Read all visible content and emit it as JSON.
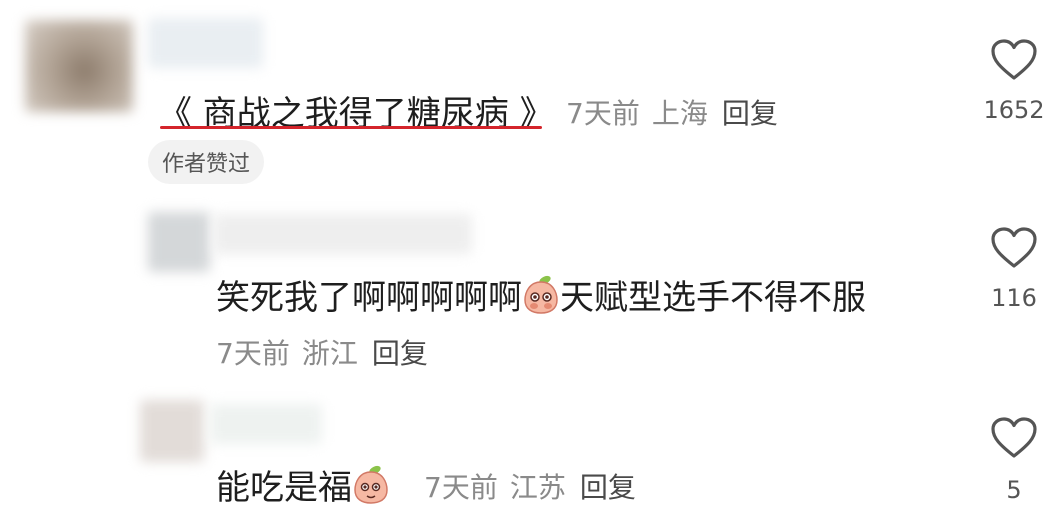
{
  "comments": [
    {
      "text": "《 商战之我得了糖尿病 》",
      "time": "7天前",
      "location": "上海",
      "reply_label": "回复",
      "badge": "作者赞过",
      "likes": "1652"
    },
    {
      "text_before_emoji": "笑死我了啊啊啊啊啊",
      "text_after_emoji": "天赋型选手不得不服",
      "time": "7天前",
      "location": "浙江",
      "reply_label": "回复",
      "likes": "116"
    },
    {
      "text_before_emoji": "能吃是福",
      "time": "7天前",
      "location": "江苏",
      "reply_label": "回复",
      "likes": "5"
    }
  ],
  "icons": {
    "like": "heart-outline-icon",
    "emoji": "peach-face-emoji-icon"
  },
  "colors": {
    "underline": "#d4242b",
    "meta": "#8a8a8a",
    "heart": "#555555"
  }
}
